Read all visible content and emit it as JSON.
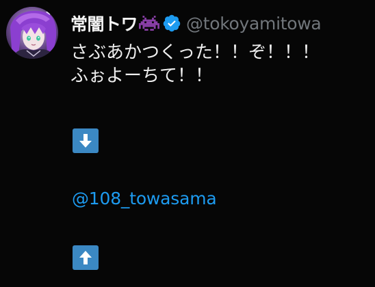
{
  "post": {
    "author": {
      "display_name": "常闇トワ",
      "handle": "@tokoyamitowa",
      "verified": true,
      "name_emoji": "space-invader-icon"
    },
    "text_lines": [
      "さぶあかつくった！！ぞ！！！",
      "ふぉよーちて！！"
    ],
    "emoji_down": "down-arrow-icon",
    "mention": "@108_towasama",
    "emoji_up": "up-arrow-icon"
  },
  "colors": {
    "background": "#060606",
    "text": "#eeeeee",
    "handle": "#71767b",
    "mention": "#1d9bf0",
    "verified_badge": "#1d9bf0",
    "emoji_box": "#3b88c3",
    "invader": "#8a3fa8"
  }
}
